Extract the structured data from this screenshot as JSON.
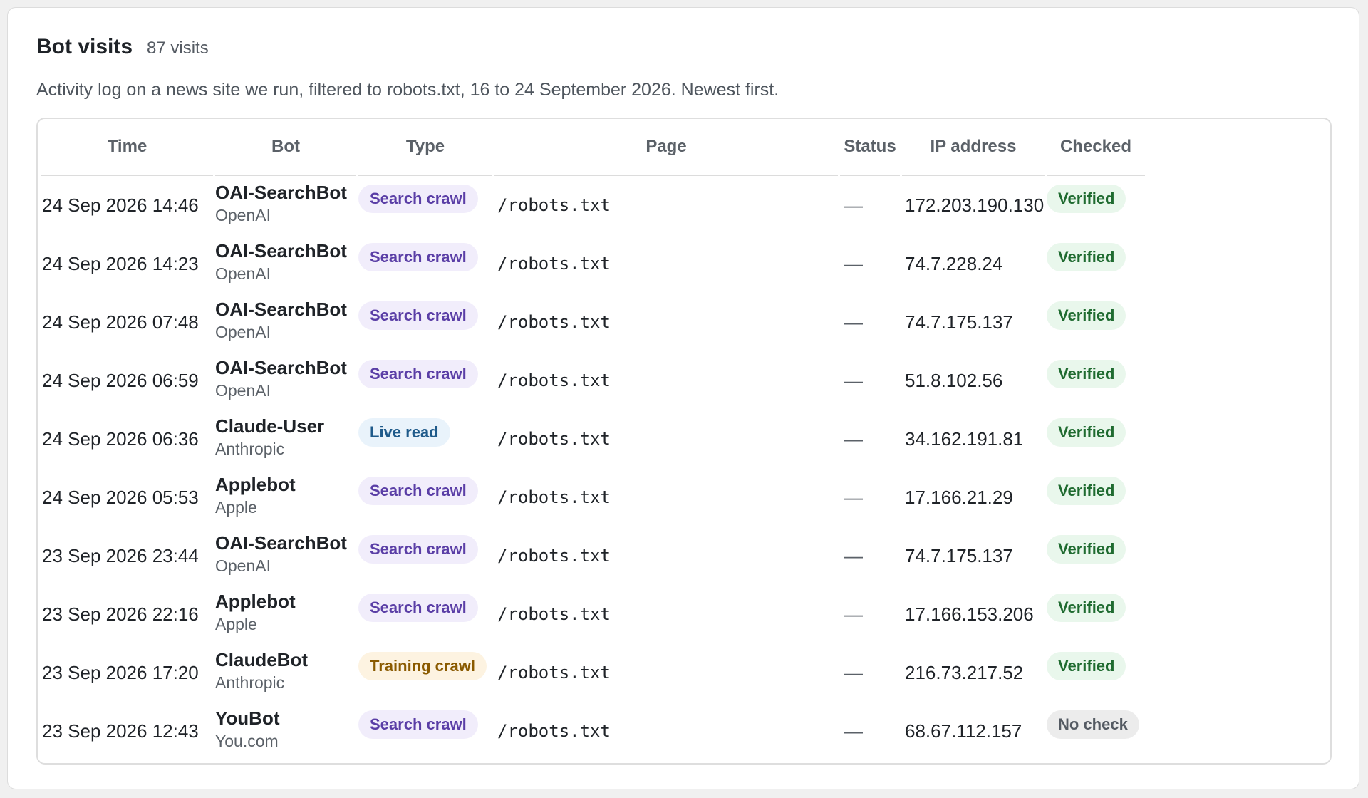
{
  "card": {
    "title": "Bot visits",
    "count": "87 visits",
    "subtitle": "Activity log on a news site we run, filtered to robots.txt, 16 to 24 September 2026. Newest first."
  },
  "table": {
    "columns": [
      "Time",
      "Bot",
      "Type",
      "Page",
      "Status",
      "IP address",
      "Checked"
    ],
    "rows": [
      {
        "time": "24 Sep 2026 14:46",
        "bot": "OAI-SearchBot",
        "org": "OpenAI",
        "type": "Search crawl",
        "type_kind": "search",
        "page": "/robots.txt",
        "status": "—",
        "ip": "172.203.190.130",
        "checked": "Verified",
        "checked_kind": "verified"
      },
      {
        "time": "24 Sep 2026 14:23",
        "bot": "OAI-SearchBot",
        "org": "OpenAI",
        "type": "Search crawl",
        "type_kind": "search",
        "page": "/robots.txt",
        "status": "—",
        "ip": "74.7.228.24",
        "checked": "Verified",
        "checked_kind": "verified"
      },
      {
        "time": "24 Sep 2026 07:48",
        "bot": "OAI-SearchBot",
        "org": "OpenAI",
        "type": "Search crawl",
        "type_kind": "search",
        "page": "/robots.txt",
        "status": "—",
        "ip": "74.7.175.137",
        "checked": "Verified",
        "checked_kind": "verified"
      },
      {
        "time": "24 Sep 2026 06:59",
        "bot": "OAI-SearchBot",
        "org": "OpenAI",
        "type": "Search crawl",
        "type_kind": "search",
        "page": "/robots.txt",
        "status": "—",
        "ip": "51.8.102.56",
        "checked": "Verified",
        "checked_kind": "verified"
      },
      {
        "time": "24 Sep 2026 06:36",
        "bot": "Claude-User",
        "org": "Anthropic",
        "type": "Live read",
        "type_kind": "live",
        "page": "/robots.txt",
        "status": "—",
        "ip": "34.162.191.81",
        "checked": "Verified",
        "checked_kind": "verified"
      },
      {
        "time": "24 Sep 2026 05:53",
        "bot": "Applebot",
        "org": "Apple",
        "type": "Search crawl",
        "type_kind": "search",
        "page": "/robots.txt",
        "status": "—",
        "ip": "17.166.21.29",
        "checked": "Verified",
        "checked_kind": "verified"
      },
      {
        "time": "23 Sep 2026 23:44",
        "bot": "OAI-SearchBot",
        "org": "OpenAI",
        "type": "Search crawl",
        "type_kind": "search",
        "page": "/robots.txt",
        "status": "—",
        "ip": "74.7.175.137",
        "checked": "Verified",
        "checked_kind": "verified"
      },
      {
        "time": "23 Sep 2026 22:16",
        "bot": "Applebot",
        "org": "Apple",
        "type": "Search crawl",
        "type_kind": "search",
        "page": "/robots.txt",
        "status": "—",
        "ip": "17.166.153.206",
        "checked": "Verified",
        "checked_kind": "verified"
      },
      {
        "time": "23 Sep 2026 17:20",
        "bot": "ClaudeBot",
        "org": "Anthropic",
        "type": "Training crawl",
        "type_kind": "training",
        "page": "/robots.txt",
        "status": "—",
        "ip": "216.73.217.52",
        "checked": "Verified",
        "checked_kind": "verified"
      },
      {
        "time": "23 Sep 2026 12:43",
        "bot": "YouBot",
        "org": "You.com",
        "type": "Search crawl",
        "type_kind": "search",
        "page": "/robots.txt",
        "status": "—",
        "ip": "68.67.112.157",
        "checked": "No check",
        "checked_kind": "nocheck"
      }
    ]
  },
  "colors": {
    "search_pill_bg": "#f1edfb",
    "search_pill_text": "#5a3ea6",
    "live_pill_bg": "#e9f3fb",
    "live_pill_text": "#1e5a8a",
    "training_pill_bg": "#fdf3e1",
    "training_pill_text": "#8a5a00",
    "verified_pill_bg": "#e9f7ec",
    "verified_pill_text": "#1f6b30",
    "nocheck_pill_bg": "#ececec",
    "nocheck_pill_text": "#555b63"
  }
}
